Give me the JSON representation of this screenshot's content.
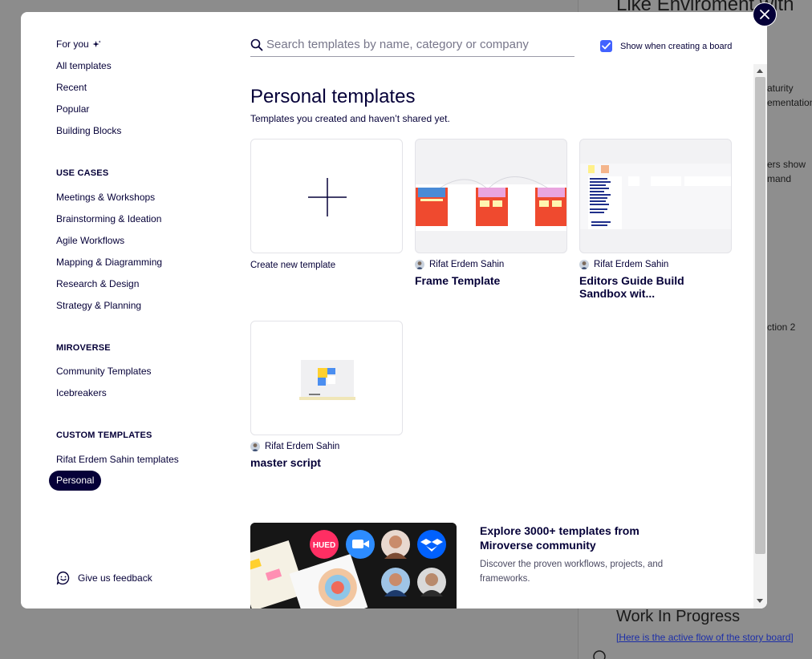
{
  "background": {
    "board_title": "Like Enviroment with",
    "fragments": [
      "aturity",
      "ementation",
      "ers show",
      "mand",
      "ction 2"
    ],
    "wip_title": "Work In Progress",
    "wip_link": "[Here is the active flow of the story board]"
  },
  "sidebar": {
    "top_items": [
      {
        "label": "For you",
        "icon": "sparkle-icon"
      },
      {
        "label": "All templates"
      },
      {
        "label": "Recent"
      },
      {
        "label": "Popular"
      },
      {
        "label": "Building Blocks"
      }
    ],
    "use_cases_heading": "USE CASES",
    "use_cases": [
      "Meetings & Workshops",
      "Brainstorming & Ideation",
      "Agile Workflows",
      "Mapping & Diagramming",
      "Research & Design",
      "Strategy & Planning"
    ],
    "miroverse_heading": "MIROVERSE",
    "miroverse": [
      "Community Templates",
      "Icebreakers"
    ],
    "custom_heading": "CUSTOM TEMPLATES",
    "custom": [
      "Rifat Erdem Sahin templates"
    ],
    "active_item": "Personal",
    "feedback_label": "Give us feedback"
  },
  "search": {
    "placeholder": "Search templates by name, category or company"
  },
  "show_when_creating": {
    "label": "Show when creating a board",
    "checked": true
  },
  "content": {
    "title": "Personal templates",
    "subtitle": "Templates you created and haven’t shared yet.",
    "create_label": "Create new template",
    "cards": [
      {
        "author": "Rifat Erdem Sahin",
        "name": "Frame Template"
      },
      {
        "author": "Rifat Erdem Sahin",
        "name": "Editors Guide Build Sandbox wit..."
      },
      {
        "author": "Rifat Erdem Sahin",
        "name": "master script"
      }
    ]
  },
  "explore": {
    "title": "Explore 3000+ templates from Miroverse community",
    "description": "Discover the proven workflows, projects, and frameworks.",
    "badge_text": "HUED"
  },
  "colors": {
    "ink": "#050038",
    "accent": "#4262ff",
    "overlay": "#8c8c8c"
  }
}
